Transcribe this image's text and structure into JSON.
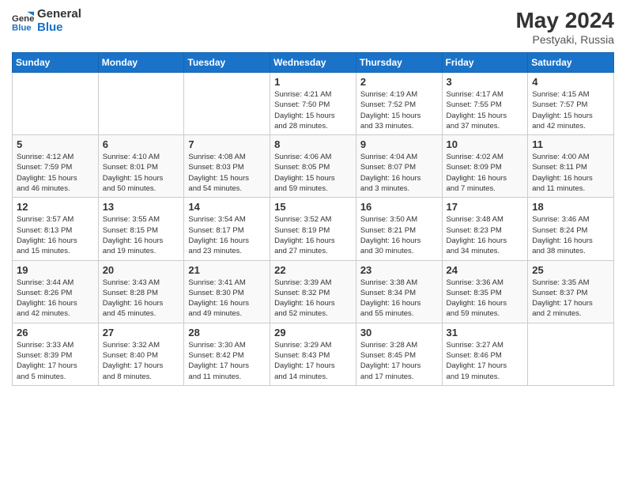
{
  "logo": {
    "line1": "General",
    "line2": "Blue"
  },
  "title": "May 2024",
  "location": "Pestyaki, Russia",
  "days_header": [
    "Sunday",
    "Monday",
    "Tuesday",
    "Wednesday",
    "Thursday",
    "Friday",
    "Saturday"
  ],
  "weeks": [
    [
      {
        "day": "",
        "info": ""
      },
      {
        "day": "",
        "info": ""
      },
      {
        "day": "",
        "info": ""
      },
      {
        "day": "1",
        "info": "Sunrise: 4:21 AM\nSunset: 7:50 PM\nDaylight: 15 hours\nand 28 minutes."
      },
      {
        "day": "2",
        "info": "Sunrise: 4:19 AM\nSunset: 7:52 PM\nDaylight: 15 hours\nand 33 minutes."
      },
      {
        "day": "3",
        "info": "Sunrise: 4:17 AM\nSunset: 7:55 PM\nDaylight: 15 hours\nand 37 minutes."
      },
      {
        "day": "4",
        "info": "Sunrise: 4:15 AM\nSunset: 7:57 PM\nDaylight: 15 hours\nand 42 minutes."
      }
    ],
    [
      {
        "day": "5",
        "info": "Sunrise: 4:12 AM\nSunset: 7:59 PM\nDaylight: 15 hours\nand 46 minutes."
      },
      {
        "day": "6",
        "info": "Sunrise: 4:10 AM\nSunset: 8:01 PM\nDaylight: 15 hours\nand 50 minutes."
      },
      {
        "day": "7",
        "info": "Sunrise: 4:08 AM\nSunset: 8:03 PM\nDaylight: 15 hours\nand 54 minutes."
      },
      {
        "day": "8",
        "info": "Sunrise: 4:06 AM\nSunset: 8:05 PM\nDaylight: 15 hours\nand 59 minutes."
      },
      {
        "day": "9",
        "info": "Sunrise: 4:04 AM\nSunset: 8:07 PM\nDaylight: 16 hours\nand 3 minutes."
      },
      {
        "day": "10",
        "info": "Sunrise: 4:02 AM\nSunset: 8:09 PM\nDaylight: 16 hours\nand 7 minutes."
      },
      {
        "day": "11",
        "info": "Sunrise: 4:00 AM\nSunset: 8:11 PM\nDaylight: 16 hours\nand 11 minutes."
      }
    ],
    [
      {
        "day": "12",
        "info": "Sunrise: 3:57 AM\nSunset: 8:13 PM\nDaylight: 16 hours\nand 15 minutes."
      },
      {
        "day": "13",
        "info": "Sunrise: 3:55 AM\nSunset: 8:15 PM\nDaylight: 16 hours\nand 19 minutes."
      },
      {
        "day": "14",
        "info": "Sunrise: 3:54 AM\nSunset: 8:17 PM\nDaylight: 16 hours\nand 23 minutes."
      },
      {
        "day": "15",
        "info": "Sunrise: 3:52 AM\nSunset: 8:19 PM\nDaylight: 16 hours\nand 27 minutes."
      },
      {
        "day": "16",
        "info": "Sunrise: 3:50 AM\nSunset: 8:21 PM\nDaylight: 16 hours\nand 30 minutes."
      },
      {
        "day": "17",
        "info": "Sunrise: 3:48 AM\nSunset: 8:23 PM\nDaylight: 16 hours\nand 34 minutes."
      },
      {
        "day": "18",
        "info": "Sunrise: 3:46 AM\nSunset: 8:24 PM\nDaylight: 16 hours\nand 38 minutes."
      }
    ],
    [
      {
        "day": "19",
        "info": "Sunrise: 3:44 AM\nSunset: 8:26 PM\nDaylight: 16 hours\nand 42 minutes."
      },
      {
        "day": "20",
        "info": "Sunrise: 3:43 AM\nSunset: 8:28 PM\nDaylight: 16 hours\nand 45 minutes."
      },
      {
        "day": "21",
        "info": "Sunrise: 3:41 AM\nSunset: 8:30 PM\nDaylight: 16 hours\nand 49 minutes."
      },
      {
        "day": "22",
        "info": "Sunrise: 3:39 AM\nSunset: 8:32 PM\nDaylight: 16 hours\nand 52 minutes."
      },
      {
        "day": "23",
        "info": "Sunrise: 3:38 AM\nSunset: 8:34 PM\nDaylight: 16 hours\nand 55 minutes."
      },
      {
        "day": "24",
        "info": "Sunrise: 3:36 AM\nSunset: 8:35 PM\nDaylight: 16 hours\nand 59 minutes."
      },
      {
        "day": "25",
        "info": "Sunrise: 3:35 AM\nSunset: 8:37 PM\nDaylight: 17 hours\nand 2 minutes."
      }
    ],
    [
      {
        "day": "26",
        "info": "Sunrise: 3:33 AM\nSunset: 8:39 PM\nDaylight: 17 hours\nand 5 minutes."
      },
      {
        "day": "27",
        "info": "Sunrise: 3:32 AM\nSunset: 8:40 PM\nDaylight: 17 hours\nand 8 minutes."
      },
      {
        "day": "28",
        "info": "Sunrise: 3:30 AM\nSunset: 8:42 PM\nDaylight: 17 hours\nand 11 minutes."
      },
      {
        "day": "29",
        "info": "Sunrise: 3:29 AM\nSunset: 8:43 PM\nDaylight: 17 hours\nand 14 minutes."
      },
      {
        "day": "30",
        "info": "Sunrise: 3:28 AM\nSunset: 8:45 PM\nDaylight: 17 hours\nand 17 minutes."
      },
      {
        "day": "31",
        "info": "Sunrise: 3:27 AM\nSunset: 8:46 PM\nDaylight: 17 hours\nand 19 minutes."
      },
      {
        "day": "",
        "info": ""
      }
    ]
  ]
}
